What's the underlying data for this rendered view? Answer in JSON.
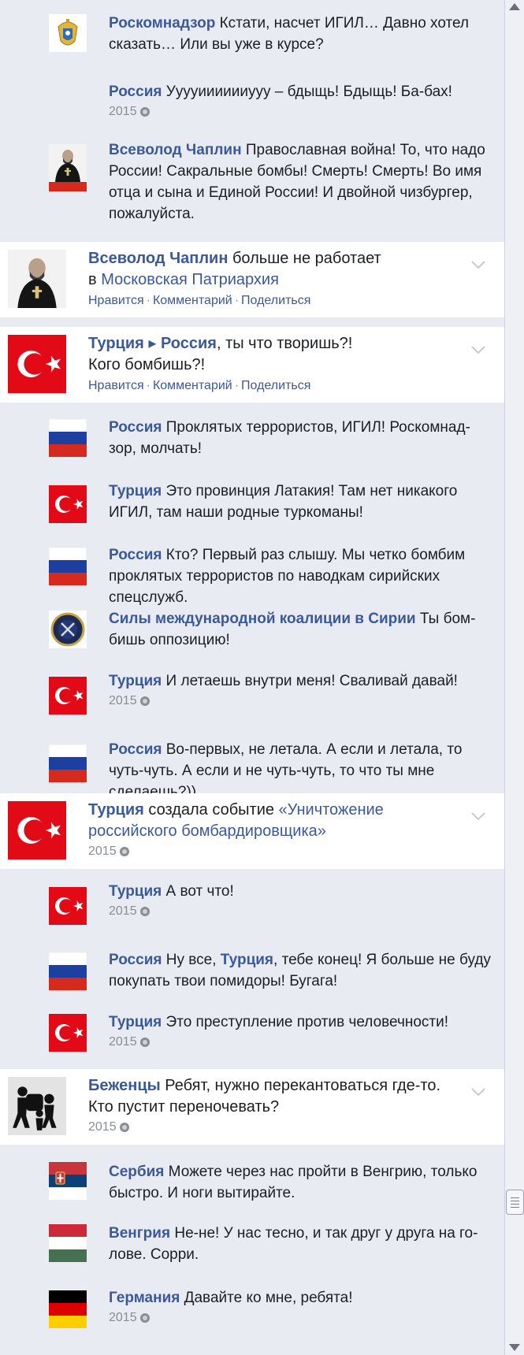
{
  "feed": [
    {
      "kind": "comment",
      "author": "Роскомнадзор",
      "text": " Кстати, насчет ИГИЛ… Давно хотел сказать… Или вы уже в курсе?",
      "avatar": "emblem-roskomnadzor"
    },
    {
      "kind": "comment",
      "author": "Россия",
      "text": " Ууууииииииууу – бдыщь! Бдыщь! Ба-бах!",
      "meta": "2015",
      "avatar": "flag-russia"
    },
    {
      "kind": "comment",
      "author": "Всеволод Чаплин",
      "text": " Православная война! То, что надо России! Сакральные бомбы! Смерть! Смерть! Во имя отца и сына и Единой России! И двойной чизбургер, пожалуйста.",
      "avatar": "photo-chaplin"
    },
    {
      "kind": "post",
      "author": "Всеволод Чаплин",
      "text": " больше не работает",
      "line2_prefix": "в ",
      "line2_link": "Московская Патриархия",
      "actions": [
        "Нравится",
        "Комментарий",
        "Поделиться"
      ],
      "avatar": "photo-chaplin"
    },
    {
      "kind": "post",
      "author": "Турция",
      "arrow": " ▸ ",
      "target": "Россия",
      "text": ", ты что творишь?!",
      "line2": "Кого бомбишь?!",
      "actions": [
        "Нравится",
        "Комментарий",
        "Поделиться"
      ],
      "avatar": "flag-turkey"
    },
    {
      "kind": "comment",
      "author": "Россия",
      "text": " Проклятых террористов, ИГИЛ! Роскомнад­зор, молчать!",
      "avatar": "flag-russia"
    },
    {
      "kind": "comment",
      "author": "Турция",
      "text": " Это провинция Латакия! Там нет никакого ИГИЛ, там наши родные туркоманы!",
      "avatar": "flag-turkey"
    },
    {
      "kind": "comment",
      "author": "Россия",
      "text": " Кто? Первый раз слышу. Мы четко бомбим про­клятых террористов по наводкам сирийских спецслужб.",
      "avatar": "flag-russia"
    },
    {
      "kind": "comment",
      "author": "Силы международной коалиции в Сирии",
      "text": " Ты бом­бишь оппозицию!",
      "avatar": "emblem-coalition"
    },
    {
      "kind": "comment",
      "author": "Турция",
      "text": " И летаешь внутри меня! Сваливай давай!",
      "meta": "2015",
      "avatar": "flag-turkey"
    },
    {
      "kind": "comment",
      "author": "Россия",
      "text": " Во-первых, не летала. А если и летала, то чуть-чуть. А если и не чуть-чуть, то что ты мне сделаешь?))",
      "avatar": "flag-russia"
    },
    {
      "kind": "post",
      "author": "Турция",
      "text": " создала событие ",
      "link": "«Уничтожение российского бомбардировщика»",
      "meta": "2015",
      "avatar": "flag-turkey"
    },
    {
      "kind": "comment",
      "author": "Турция",
      "text": " А вот что!",
      "meta": "2015",
      "avatar": "flag-turkey"
    },
    {
      "kind": "comment",
      "author": "Россия",
      "text": " Ну все, ",
      "mention": "Турция",
      "text2": ", тебе конец! Я больше не буду покупать твои помидоры! Бугага!",
      "avatar": "flag-russia"
    },
    {
      "kind": "comment",
      "author": "Турция",
      "text": " Это преступление против человечности!",
      "meta": "2015",
      "avatar": "flag-turkey"
    },
    {
      "kind": "post",
      "author": "Беженцы",
      "text": " Ребят, нужно перекантоваться где-то. Кто пустит переночевать?",
      "meta": "2015",
      "avatar": "icon-refugees"
    },
    {
      "kind": "comment",
      "author": "Сербия",
      "text": " Можете через нас пройти в Венгрию, только быстро. И ноги вытирайте.",
      "avatar": "flag-serbia"
    },
    {
      "kind": "comment",
      "author": "Венгрия",
      "text": " Не-не! У нас тесно, и так друг у друга на го­лове. Сорри.",
      "avatar": "flag-hungary"
    },
    {
      "kind": "comment",
      "author": "Германия",
      "text": " Давайте ко мне, ребята!",
      "meta": "2015",
      "avatar": "flag-germany"
    }
  ],
  "colors": {
    "link": "#3b5998",
    "text": "#1c1e21",
    "meta": "#8a8d91",
    "feed_bg": "#e9ebf3",
    "post_bg": "#ffffff",
    "russia": [
      "#ffffff",
      "#1c3fa0",
      "#d52b1e"
    ],
    "turkey": "#e30a17",
    "serbia": [
      "#c6363c",
      "#0c4076",
      "#ffffff"
    ],
    "hungary": [
      "#ce2939",
      "#ffffff",
      "#477050"
    ],
    "germany": [
      "#000000",
      "#dd0000",
      "#ffce00"
    ]
  }
}
